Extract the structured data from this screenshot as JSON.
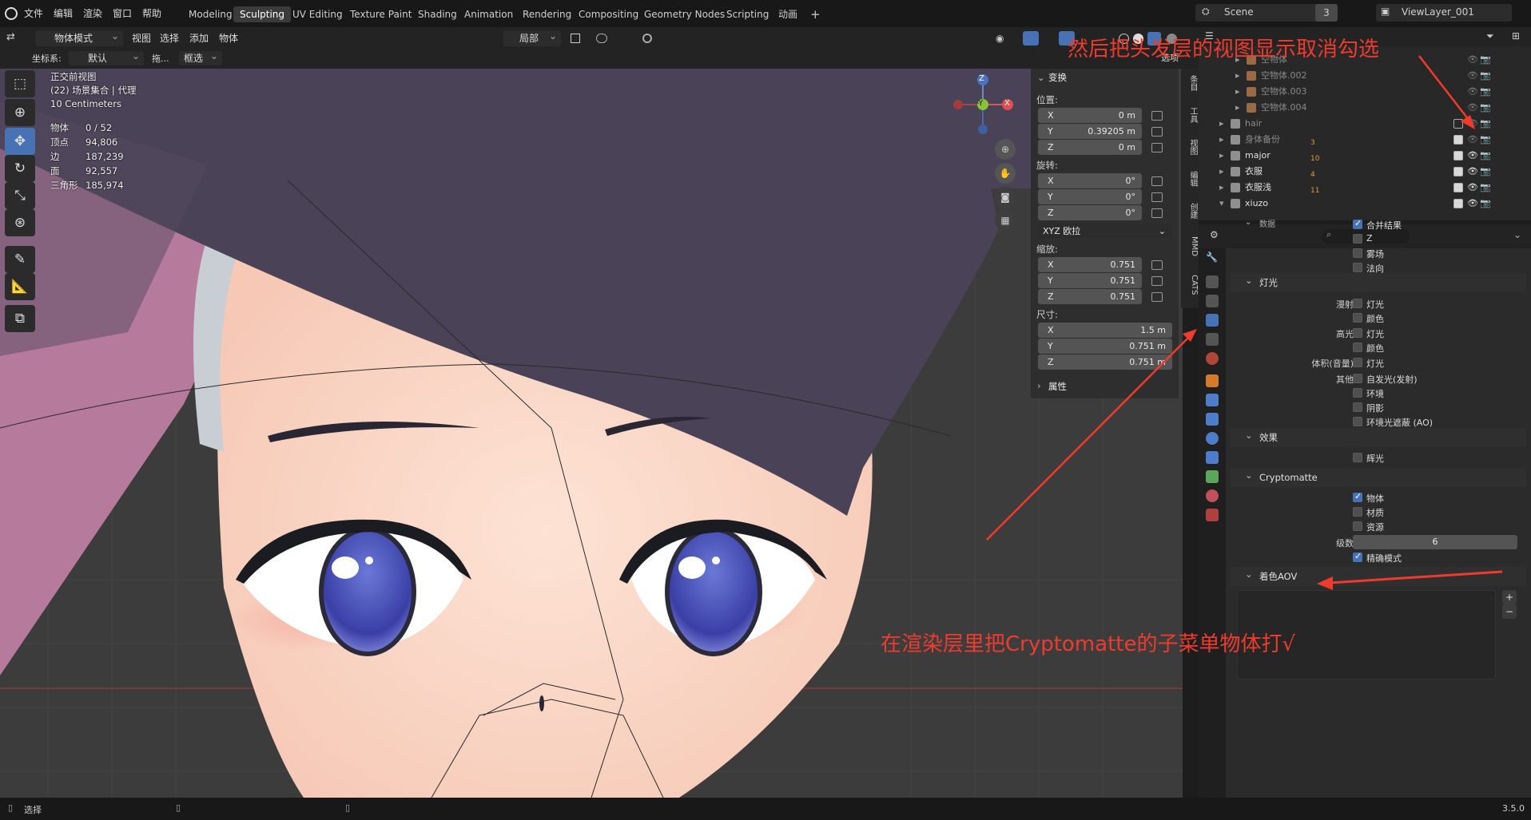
{
  "menu": [
    "文件",
    "编辑",
    "渲染",
    "窗口",
    "帮助"
  ],
  "workspaces": [
    "Modeling",
    "Sculpting",
    "UV Editing",
    "Texture Paint",
    "Shading",
    "Animation",
    "Rendering",
    "Compositing",
    "Geometry Nodes",
    "Scripting",
    "动画"
  ],
  "workspace_add": "+",
  "scene": {
    "name": "Scene",
    "count": "3"
  },
  "viewlayer": "ViewLayer_001",
  "header": {
    "mode": "物体模式",
    "items": [
      "视图",
      "选择",
      "添加",
      "物体"
    ],
    "orientation": "局部",
    "coord_label": "坐标系:",
    "coord_value": "默认",
    "drag_label": "拖...",
    "select_value": "框选",
    "options_label": "选项"
  },
  "viewport": {
    "view_name": "正交前视图",
    "collection": "(22) 场景集合 | 代理",
    "scale": "10 Centimeters",
    "stats": [
      {
        "label": "物体",
        "value": "0 / 52"
      },
      {
        "label": "顶点",
        "value": "94,806"
      },
      {
        "label": "边",
        "value": "187,239"
      },
      {
        "label": "面",
        "value": "92,557"
      },
      {
        "label": "三角形",
        "value": "185,974"
      }
    ],
    "gizmo": {
      "z": "Z",
      "y": "-Y",
      "x": "X"
    }
  },
  "npanel": {
    "transform_title": "变换",
    "location_label": "位置:",
    "location": [
      {
        "axis": "X",
        "value": "0 m"
      },
      {
        "axis": "Y",
        "value": "0.39205 m"
      },
      {
        "axis": "Z",
        "value": "0 m"
      }
    ],
    "rotation_label": "旋转:",
    "rotation": [
      {
        "axis": "X",
        "value": "0°"
      },
      {
        "axis": "Y",
        "value": "0°"
      },
      {
        "axis": "Z",
        "value": "0°"
      }
    ],
    "rotation_mode": "XYZ 欧拉",
    "scale_label": "缩放:",
    "scale": [
      {
        "axis": "X",
        "value": "0.751"
      },
      {
        "axis": "Y",
        "value": "0.751"
      },
      {
        "axis": "Z",
        "value": "0.751"
      }
    ],
    "dimensions_label": "尺寸:",
    "dimensions": [
      {
        "axis": "X",
        "value": "1.5 m"
      },
      {
        "axis": "Y",
        "value": "0.751 m"
      },
      {
        "axis": "Z",
        "value": "0.751 m"
      }
    ],
    "properties_title": "属性"
  },
  "vtabs": [
    "条目",
    "工具",
    "视图",
    "编辑",
    "创建",
    "MMD",
    "CATS"
  ],
  "outliner": [
    {
      "name": "空物体",
      "indent": 3,
      "dim": true
    },
    {
      "name": "空物体.002",
      "indent": 3,
      "dim": true
    },
    {
      "name": "空物体.003",
      "indent": 3,
      "dim": true
    },
    {
      "name": "空物体.004",
      "indent": 3,
      "dim": true
    },
    {
      "name": "hair",
      "indent": 2,
      "dim": true,
      "checked": false
    },
    {
      "name": "身体备份",
      "indent": 2,
      "dim": true,
      "checked": true,
      "badge": "3"
    },
    {
      "name": "major",
      "indent": 2,
      "dim": false,
      "checked": true,
      "badge": "10"
    },
    {
      "name": "衣服",
      "indent": 2,
      "dim": false,
      "checked": true,
      "badge": "4"
    },
    {
      "name": "衣服浅",
      "indent": 2,
      "dim": false,
      "checked": true,
      "badge": "11"
    },
    {
      "name": "xiuzo",
      "indent": 2,
      "dim": false,
      "checked": true
    }
  ],
  "props": {
    "data_section": "数据",
    "data_items": [
      {
        "label": "合并结果",
        "on": true
      },
      {
        "label": "Z",
        "on": false
      },
      {
        "label": "雾场",
        "on": false
      },
      {
        "label": "法向",
        "on": false
      }
    ],
    "light_section": "灯光",
    "diffuse_label": "漫射",
    "diffuse_items": [
      {
        "label": "灯光",
        "on": false
      },
      {
        "label": "颜色",
        "on": false
      }
    ],
    "specular_label": "高光",
    "specular_items": [
      {
        "label": "灯光",
        "on": false
      },
      {
        "label": "颜色",
        "on": false
      }
    ],
    "volume_label": "体积(音量)",
    "volume_items": [
      {
        "label": "灯光",
        "on": false
      }
    ],
    "other_label": "其他",
    "other_items": [
      {
        "label": "自发光(发射)",
        "on": false
      },
      {
        "label": "环境",
        "on": false
      },
      {
        "label": "阴影",
        "on": false
      },
      {
        "label": "环境光遮蔽 (AO)",
        "on": false
      }
    ],
    "effects_section": "效果",
    "effects_items": [
      {
        "label": "辉光",
        "on": false
      }
    ],
    "crypto_section": "Cryptomatte",
    "crypto_items": [
      {
        "label": "物体",
        "on": true
      },
      {
        "label": "材质",
        "on": false
      },
      {
        "label": "资源",
        "on": false
      }
    ],
    "levels_label": "级数",
    "levels_value": "6",
    "accurate_label": "精确模式",
    "aov_section": "着色AOV",
    "aov_add": "+",
    "aov_remove": "−"
  },
  "status": {
    "select": "选择",
    "version": "3.5.0"
  },
  "annotations": {
    "top": "然后把头发层的视图显示取消勾选",
    "bottom": "在渲染层里把Cryptomatte的子菜单物体打√"
  },
  "colors": {
    "accent": "#4772b3",
    "annotation": "#ef3b2d",
    "active_tool": "#4772b3"
  }
}
